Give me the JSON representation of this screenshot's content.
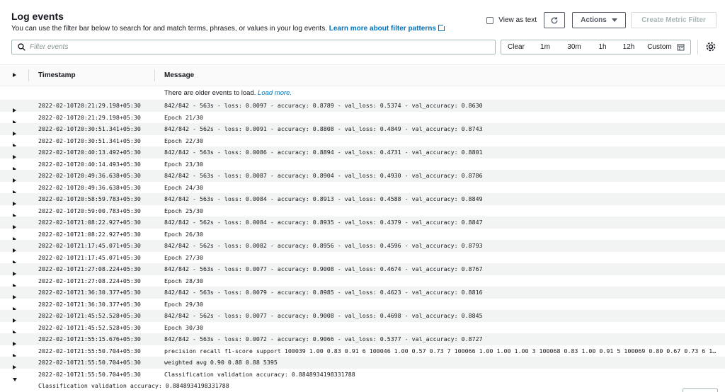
{
  "header": {
    "title": "Log events",
    "subtitle": "You can use the filter bar below to search for and match terms, phrases, or values in your log events.",
    "learn_more": "Learn more about filter patterns"
  },
  "toolbar": {
    "view_as_text": "View as text",
    "actions_label": "Actions",
    "create_metric_filter": "Create Metric Filter"
  },
  "filter": {
    "placeholder": "Filter events",
    "ranges": [
      "Clear",
      "1m",
      "30m",
      "1h",
      "12h",
      "Custom"
    ]
  },
  "table": {
    "columns": {
      "timestamp": "Timestamp",
      "message": "Message"
    },
    "older_text": "There are older events to load.",
    "load_more": "Load more.",
    "rows": [
      {
        "ts": "2022-02-10T20:21:29.198+05:30",
        "msg": "842/842 - 563s - loss: 0.0097 - accuracy: 0.8789 - val_loss: 0.5374 - val_accuracy: 0.8630"
      },
      {
        "ts": "2022-02-10T20:21:29.198+05:30",
        "msg": "Epoch 21/30"
      },
      {
        "ts": "2022-02-10T20:30:51.341+05:30",
        "msg": "842/842 - 562s - loss: 0.0091 - accuracy: 0.8808 - val_loss: 0.4849 - val_accuracy: 0.8743"
      },
      {
        "ts": "2022-02-10T20:30:51.341+05:30",
        "msg": "Epoch 22/30"
      },
      {
        "ts": "2022-02-10T20:40:13.492+05:30",
        "msg": "842/842 - 563s - loss: 0.0086 - accuracy: 0.8894 - val_loss: 0.4731 - val_accuracy: 0.8801"
      },
      {
        "ts": "2022-02-10T20:40:14.493+05:30",
        "msg": "Epoch 23/30"
      },
      {
        "ts": "2022-02-10T20:49:36.638+05:30",
        "msg": "842/842 - 563s - loss: 0.0087 - accuracy: 0.8904 - val_loss: 0.4930 - val_accuracy: 0.8786"
      },
      {
        "ts": "2022-02-10T20:49:36.638+05:30",
        "msg": "Epoch 24/30"
      },
      {
        "ts": "2022-02-10T20:58:59.783+05:30",
        "msg": "842/842 - 563s - loss: 0.0084 - accuracy: 0.8913 - val_loss: 0.4588 - val_accuracy: 0.8849"
      },
      {
        "ts": "2022-02-10T20:59:00.783+05:30",
        "msg": "Epoch 25/30"
      },
      {
        "ts": "2022-02-10T21:08:22.927+05:30",
        "msg": "842/842 - 562s - loss: 0.0084 - accuracy: 0.8935 - val_loss: 0.4379 - val_accuracy: 0.8847"
      },
      {
        "ts": "2022-02-10T21:08:22.927+05:30",
        "msg": "Epoch 26/30"
      },
      {
        "ts": "2022-02-10T21:17:45.071+05:30",
        "msg": "842/842 - 562s - loss: 0.0082 - accuracy: 0.8956 - val_loss: 0.4596 - val_accuracy: 0.8793"
      },
      {
        "ts": "2022-02-10T21:17:45.071+05:30",
        "msg": "Epoch 27/30"
      },
      {
        "ts": "2022-02-10T21:27:08.224+05:30",
        "msg": "842/842 - 563s - loss: 0.0077 - accuracy: 0.9008 - val_loss: 0.4674 - val_accuracy: 0.8767"
      },
      {
        "ts": "2022-02-10T21:27:08.224+05:30",
        "msg": "Epoch 28/30"
      },
      {
        "ts": "2022-02-10T21:36:30.377+05:30",
        "msg": "842/842 - 563s - loss: 0.0079 - accuracy: 0.8985 - val_loss: 0.4623 - val_accuracy: 0.8816"
      },
      {
        "ts": "2022-02-10T21:36:30.377+05:30",
        "msg": "Epoch 29/30"
      },
      {
        "ts": "2022-02-10T21:45:52.528+05:30",
        "msg": "842/842 - 562s - loss: 0.0077 - accuracy: 0.9008 - val_loss: 0.4698 - val_accuracy: 0.8845"
      },
      {
        "ts": "2022-02-10T21:45:52.528+05:30",
        "msg": "Epoch 30/30"
      },
      {
        "ts": "2022-02-10T21:55:15.676+05:30",
        "msg": "842/842 - 563s - loss: 0.0072 - accuracy: 0.9066 - val_loss: 0.5377 - val_accuracy: 0.8727"
      },
      {
        "ts": "2022-02-10T21:55:50.704+05:30",
        "msg": "precision recall f1-score support 100039 1.00 0.83 0.91 6 100046 1.00 0.57 0.73 7 100066 1.00 1.00 1.00 3 100068 0.83 1.00 0.91 5 100069 0.80 0.67 0.73 6 100..."
      },
      {
        "ts": "2022-02-10T21:55:50.704+05:30",
        "msg": "weighted avg 0.90 0.88 0.88 5395"
      },
      {
        "ts": "2022-02-10T21:55:50.704+05:30",
        "msg": "Classification validation accuracy: 0.8848934198331788"
      }
    ],
    "expanded_text": "Classification validation accuracy: 0.8848934198331788"
  },
  "icons": {
    "search": "search-icon",
    "refresh": "refresh-icon",
    "calendar": "calendar-icon",
    "settings": "gear-icon",
    "external": "external-link-icon"
  },
  "colors": {
    "link": "#0073bb",
    "row_alt": "#f2f3f3",
    "text": "#16191f",
    "disabled": "#aab7b8"
  }
}
